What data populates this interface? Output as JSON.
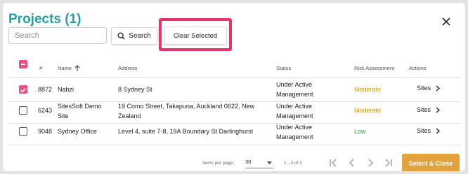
{
  "dialog": {
    "title": "Projects (1)"
  },
  "search": {
    "placeholder": "Search",
    "button_label": "Search",
    "clear_label": "Clear Selected"
  },
  "table": {
    "headers": {
      "num": "#",
      "name": "Name",
      "address": "Address",
      "status": "Status",
      "risk": "Risk Assessment",
      "actions": "Actions"
    },
    "rows": [
      {
        "checked": true,
        "num": "8872",
        "name": [
          "Nabzi"
        ],
        "address": [
          "8 Sydney St"
        ],
        "status": [
          "Under Active",
          "Management"
        ],
        "risk": "Moderate",
        "risk_color": "#d39a10",
        "action": "Sites"
      },
      {
        "checked": false,
        "num": "6243",
        "name": [
          "SitesSoft Demo",
          "Site"
        ],
        "address": [
          "19 Como Street, Takapuna, Auckland 0622, New",
          "Zealand"
        ],
        "status": [
          "Under Active",
          "Management"
        ],
        "risk": "Moderate",
        "risk_color": "#d39a10",
        "action": "Sites"
      },
      {
        "checked": false,
        "num": "9048",
        "name": [
          "Sydney Office"
        ],
        "address": [
          "Level 4, suite 7-8, 19A Boundary St Darlinghurst"
        ],
        "status": [
          "Under Active",
          "Management"
        ],
        "risk": "Low",
        "risk_color": "#2e9a45",
        "action": "Sites"
      }
    ]
  },
  "footer": {
    "items_per_page_label": "Items per page:",
    "items_per_page_value": "30",
    "range": "1 - 3 of 3",
    "primary_button": "Select & Close"
  },
  "colors": {
    "accent": "#21a0a6",
    "highlight": "#e8336a",
    "checkbox": "#ec4e82",
    "primary_button": "#e3a23c"
  }
}
